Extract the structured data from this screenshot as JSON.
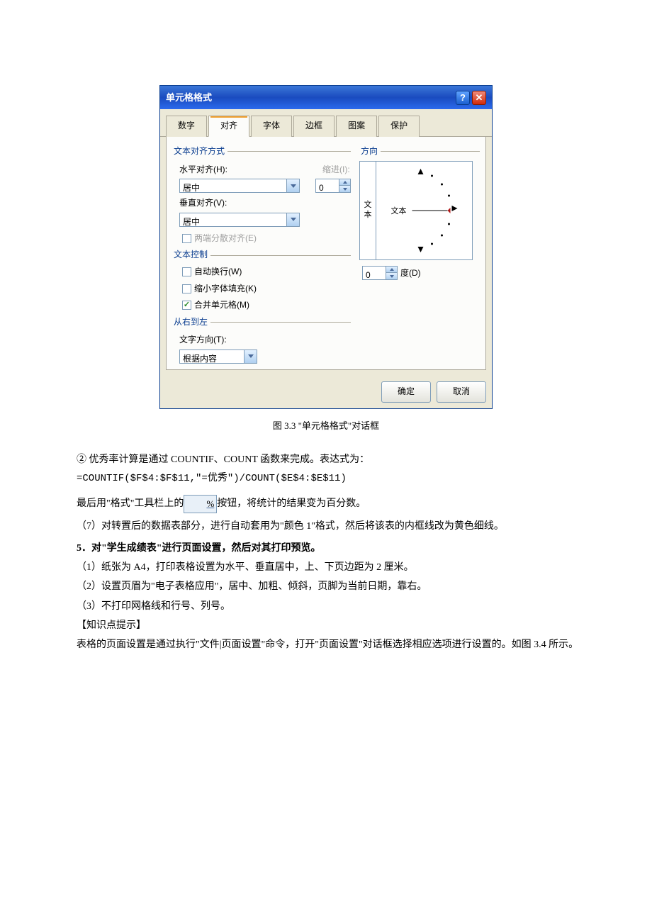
{
  "dialog": {
    "title": "单元格格式",
    "tabs": [
      "数字",
      "对齐",
      "字体",
      "边框",
      "图案",
      "保护"
    ],
    "active_tab": 1,
    "groups": {
      "text_align": "文本对齐方式",
      "orientation": "方向",
      "text_control": "文本控制",
      "rtl": "从右到左"
    },
    "labels": {
      "h_align": "水平对齐(H):",
      "v_align": "垂直对齐(V):",
      "indent": "缩进(I):",
      "justify_distributed": "两端分散对齐(E)",
      "wrap": "自动换行(W)",
      "shrink": "缩小字体填充(K)",
      "merge": "合并单元格(M)",
      "text_dir": "文字方向(T):",
      "degree_suffix": "度(D)"
    },
    "values": {
      "h_align": "居中",
      "v_align": "居中",
      "indent": "0",
      "wrap": false,
      "shrink": false,
      "merge": true,
      "text_dir": "根据内容",
      "degree": "0",
      "orient_vertical": [
        "文",
        "本"
      ],
      "orient_label": "文本"
    },
    "buttons": {
      "ok": "确定",
      "cancel": "取消"
    }
  },
  "caption": "图 3.3 \"单元格格式\"对话框",
  "body": {
    "p1": "② 优秀率计算是通过 COUNTIF、COUNT 函数来完成。表达式为：",
    "formula": "=COUNTIF($F$4:$F$11,\"=优秀\")/COUNT($E$4:$E$11)",
    "p2a": "最后用\"格式\"工具栏上的",
    "pct_icon": "%",
    "p2b": "按钮，将统计的结果变为百分数。",
    "p3": "（7）对转置后的数据表部分，进行自动套用为\"颜色 1\"格式，然后将该表的内框线改为黄色细线。",
    "h5": "5．对\"学生成绩表\"进行页面设置，然后对其打印预览。",
    "p4": "（1）纸张为 A4，打印表格设置为水平、垂直居中，上、下页边距为 2 厘米。",
    "p5": "（2）设置页眉为\"电子表格应用\"，居中、加粗、倾斜，页脚为当前日期，靠右。",
    "p6": "（3）不打印网格线和行号、列号。",
    "p7": "【知识点提示】",
    "p8": "表格的页面设置是通过执行\"文件|页面设置\"命令，打开\"页面设置\"对话框选择相应选项进行设置的。如图 3.4 所示。"
  }
}
